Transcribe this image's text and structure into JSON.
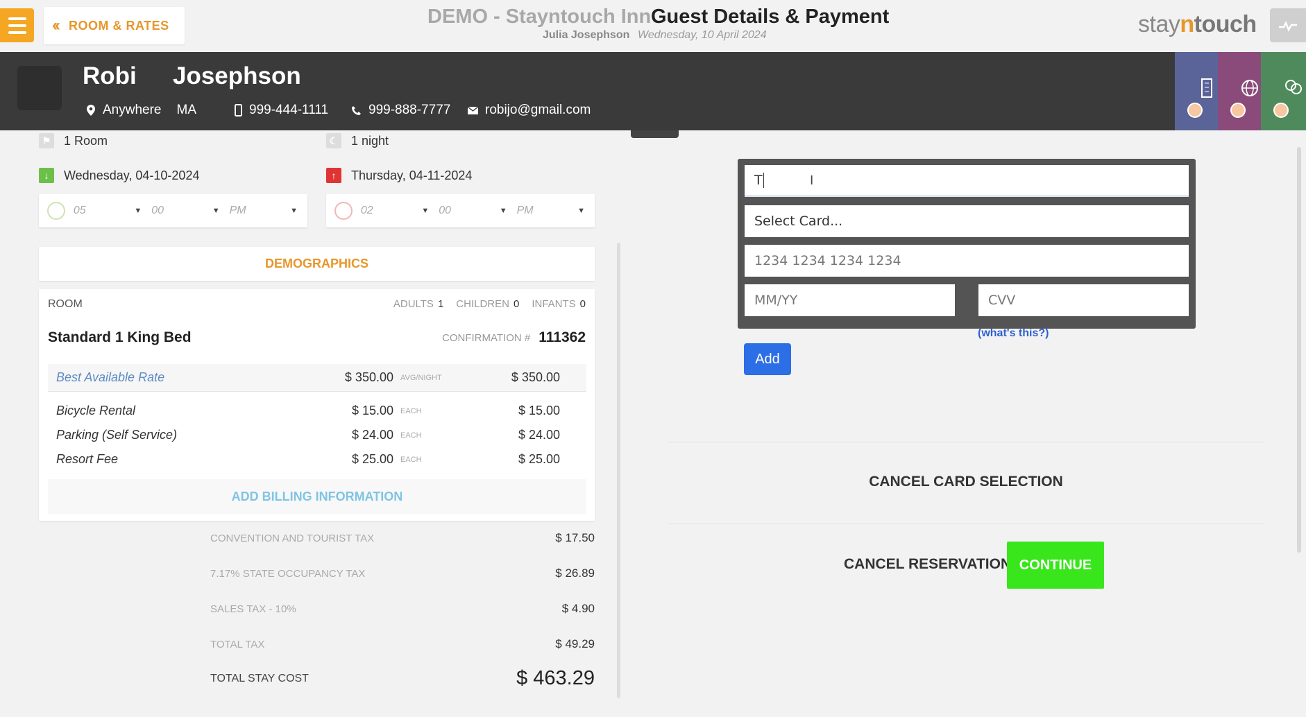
{
  "header": {
    "back_label": "ROOM & RATES",
    "hotel_name": "DEMO - Stayntouch Inn",
    "page_title": "Guest Details & Payment",
    "user_name": "Julia Josephson",
    "business_date": "Wednesday, 10 April 2024",
    "logo": {
      "part1": "stay",
      "part2": "n",
      "part3": "touch"
    },
    "icons": {
      "menu": "hamburger-icon",
      "back": "double-chevron-left-icon",
      "activity": "pulse-icon"
    }
  },
  "guest": {
    "first_name": "Robi",
    "last_name": "Josephson",
    "city": "Anywhere",
    "state": "MA",
    "mobile": "999-444-1111",
    "phone": "999-888-7777",
    "email": "robijo@gmail.com",
    "icons": {
      "location": "map-pin-icon",
      "mobile": "mobile-phone-icon",
      "phone": "phone-icon",
      "email": "envelope-icon"
    }
  },
  "side_tabs": [
    {
      "name": "building-icon",
      "color": "#5b6499"
    },
    {
      "name": "globe-icon",
      "color": "#8a4b7a"
    },
    {
      "name": "rings-icon",
      "color": "#4f8a5c"
    }
  ],
  "stay": {
    "rooms": "1 Room",
    "nights": "1 night",
    "arrival_date": "Wednesday, 04-10-2024",
    "departure_date": "Thursday, 04-11-2024",
    "arrival_time": {
      "hour": "05",
      "minute": "00",
      "ampm": "PM"
    },
    "departure_time": {
      "hour": "02",
      "minute": "00",
      "ampm": "PM"
    }
  },
  "demographics_label": "DEMOGRAPHICS",
  "room": {
    "label": "ROOM",
    "adults_label": "ADULTS",
    "adults": "1",
    "children_label": "CHILDREN",
    "children": "0",
    "infants_label": "INFANTS",
    "infants": "0",
    "room_type": "Standard 1 King Bed",
    "confirmation_label": "CONFIRMATION #",
    "confirmation_number": "111362",
    "rate": {
      "name": "Best Available Rate",
      "amount": "$ 350.00",
      "unit": "AVG/NIGHT",
      "total": "$ 350.00"
    },
    "addons": [
      {
        "name": "Bicycle Rental",
        "amount": "$ 15.00",
        "unit": "EACH",
        "total": "$ 15.00"
      },
      {
        "name": "Parking (Self Service)",
        "amount": "$ 24.00",
        "unit": "EACH",
        "total": "$ 24.00"
      },
      {
        "name": "Resort Fee",
        "amount": "$ 25.00",
        "unit": "EACH",
        "total": "$ 25.00"
      }
    ],
    "add_billing_label": "ADD BILLING INFORMATION"
  },
  "taxes": [
    {
      "label": "CONVENTION AND TOURIST TAX",
      "value": "$ 17.50"
    },
    {
      "label": "7.17% STATE OCCUPANCY TAX",
      "value": "$ 26.89"
    },
    {
      "label": "SALES TAX - 10%",
      "value": "$ 4.90"
    },
    {
      "label": "TOTAL TAX",
      "value": "$ 49.29"
    }
  ],
  "total_stay": {
    "label": "TOTAL STAY COST",
    "value": "$ 463.29"
  },
  "payment": {
    "name_value": "T",
    "card_select": "Select Card...",
    "card_number_placeholder": "1234 1234 1234 1234",
    "expiry_placeholder": "MM/YY",
    "cvv_placeholder": "CVV",
    "whats_this": "(what's this?)",
    "add_label": "Add",
    "cancel_card_label": "CANCEL CARD SELECTION",
    "cancel_reservation_label": "CANCEL RESERVATION",
    "continue_label": "CONTINUE"
  },
  "colors": {
    "accent": "#e8962a",
    "guest_bar": "#3a3a3a",
    "continue": "#39e61c",
    "add_button": "#2c6ee6",
    "link": "#2f5fd4",
    "billing_link": "#7fc4e4"
  }
}
